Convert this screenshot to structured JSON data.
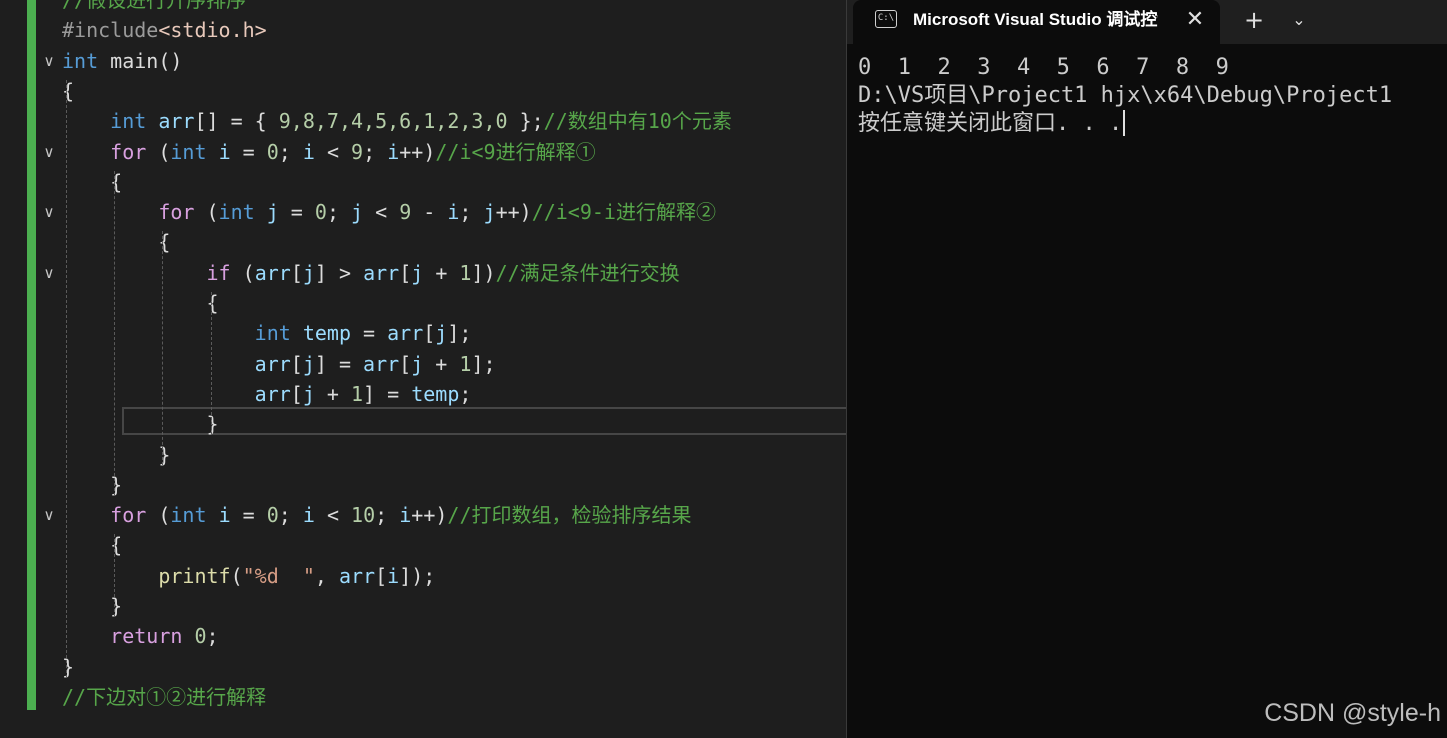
{
  "editor": {
    "lines": [
      {
        "segments": [
          {
            "cls": "cmt",
            "text": "//假设进行升序排序"
          }
        ]
      },
      {
        "segments": [
          {
            "cls": "pp",
            "text": "#include"
          },
          {
            "cls": "inc",
            "text": "<stdio.h>"
          }
        ]
      },
      {
        "segments": [
          {
            "cls": "kw",
            "text": "int"
          },
          {
            "cls": "pl",
            "text": " main()"
          }
        ]
      },
      {
        "segments": [
          {
            "cls": "pl",
            "text": "{"
          }
        ]
      },
      {
        "segments": [
          {
            "cls": "pl",
            "text": "    "
          },
          {
            "cls": "kw",
            "text": "int"
          },
          {
            "cls": "pl",
            "text": " "
          },
          {
            "cls": "id",
            "text": "arr"
          },
          {
            "cls": "pl",
            "text": "[] = { "
          },
          {
            "cls": "num",
            "text": "9,8,7,4,5,6,1,2,3,0"
          },
          {
            "cls": "pl",
            "text": " };"
          },
          {
            "cls": "cmt",
            "text": "//数组中有10个元素"
          }
        ]
      },
      {
        "segments": [
          {
            "cls": "pl",
            "text": "    "
          },
          {
            "cls": "ctl",
            "text": "for"
          },
          {
            "cls": "pl",
            "text": " ("
          },
          {
            "cls": "kw",
            "text": "int"
          },
          {
            "cls": "pl",
            "text": " "
          },
          {
            "cls": "id",
            "text": "i"
          },
          {
            "cls": "pl",
            "text": " = "
          },
          {
            "cls": "num",
            "text": "0"
          },
          {
            "cls": "pl",
            "text": "; "
          },
          {
            "cls": "id",
            "text": "i"
          },
          {
            "cls": "pl",
            "text": " < "
          },
          {
            "cls": "num",
            "text": "9"
          },
          {
            "cls": "pl",
            "text": "; "
          },
          {
            "cls": "id",
            "text": "i"
          },
          {
            "cls": "pl",
            "text": "++)"
          },
          {
            "cls": "cmt",
            "text": "//i<9进行解释①"
          }
        ]
      },
      {
        "segments": [
          {
            "cls": "pl",
            "text": "    {"
          }
        ]
      },
      {
        "segments": [
          {
            "cls": "pl",
            "text": "        "
          },
          {
            "cls": "ctl",
            "text": "for"
          },
          {
            "cls": "pl",
            "text": " ("
          },
          {
            "cls": "kw",
            "text": "int"
          },
          {
            "cls": "pl",
            "text": " "
          },
          {
            "cls": "id",
            "text": "j"
          },
          {
            "cls": "pl",
            "text": " = "
          },
          {
            "cls": "num",
            "text": "0"
          },
          {
            "cls": "pl",
            "text": "; "
          },
          {
            "cls": "id",
            "text": "j"
          },
          {
            "cls": "pl",
            "text": " < "
          },
          {
            "cls": "num",
            "text": "9"
          },
          {
            "cls": "pl",
            "text": " - "
          },
          {
            "cls": "id",
            "text": "i"
          },
          {
            "cls": "pl",
            "text": "; "
          },
          {
            "cls": "id",
            "text": "j"
          },
          {
            "cls": "pl",
            "text": "++)"
          },
          {
            "cls": "cmt",
            "text": "//i<9-i进行解释②"
          }
        ]
      },
      {
        "segments": [
          {
            "cls": "pl",
            "text": "        {"
          }
        ]
      },
      {
        "segments": [
          {
            "cls": "pl",
            "text": "            "
          },
          {
            "cls": "ctl",
            "text": "if"
          },
          {
            "cls": "pl",
            "text": " ("
          },
          {
            "cls": "id",
            "text": "arr"
          },
          {
            "cls": "pl",
            "text": "["
          },
          {
            "cls": "id",
            "text": "j"
          },
          {
            "cls": "pl",
            "text": "] > "
          },
          {
            "cls": "id",
            "text": "arr"
          },
          {
            "cls": "pl",
            "text": "["
          },
          {
            "cls": "id",
            "text": "j"
          },
          {
            "cls": "pl",
            "text": " + "
          },
          {
            "cls": "num",
            "text": "1"
          },
          {
            "cls": "pl",
            "text": "])"
          },
          {
            "cls": "cmt",
            "text": "//满足条件进行交换"
          }
        ]
      },
      {
        "segments": [
          {
            "cls": "pl",
            "text": "            {"
          }
        ]
      },
      {
        "segments": [
          {
            "cls": "pl",
            "text": "                "
          },
          {
            "cls": "kw",
            "text": "int"
          },
          {
            "cls": "pl",
            "text": " "
          },
          {
            "cls": "id",
            "text": "temp"
          },
          {
            "cls": "pl",
            "text": " = "
          },
          {
            "cls": "id",
            "text": "arr"
          },
          {
            "cls": "pl",
            "text": "["
          },
          {
            "cls": "id",
            "text": "j"
          },
          {
            "cls": "pl",
            "text": "];"
          }
        ]
      },
      {
        "segments": [
          {
            "cls": "pl",
            "text": "                "
          },
          {
            "cls": "id",
            "text": "arr"
          },
          {
            "cls": "pl",
            "text": "["
          },
          {
            "cls": "id",
            "text": "j"
          },
          {
            "cls": "pl",
            "text": "] = "
          },
          {
            "cls": "id",
            "text": "arr"
          },
          {
            "cls": "pl",
            "text": "["
          },
          {
            "cls": "id",
            "text": "j"
          },
          {
            "cls": "pl",
            "text": " + "
          },
          {
            "cls": "num",
            "text": "1"
          },
          {
            "cls": "pl",
            "text": "];"
          }
        ]
      },
      {
        "segments": [
          {
            "cls": "pl",
            "text": "                "
          },
          {
            "cls": "id",
            "text": "arr"
          },
          {
            "cls": "pl",
            "text": "["
          },
          {
            "cls": "id",
            "text": "j"
          },
          {
            "cls": "pl",
            "text": " + "
          },
          {
            "cls": "num",
            "text": "1"
          },
          {
            "cls": "pl",
            "text": "] = "
          },
          {
            "cls": "id",
            "text": "temp"
          },
          {
            "cls": "pl",
            "text": ";"
          }
        ]
      },
      {
        "segments": [
          {
            "cls": "pl",
            "text": "            }"
          }
        ]
      },
      {
        "segments": [
          {
            "cls": "pl",
            "text": "        }"
          }
        ]
      },
      {
        "segments": [
          {
            "cls": "pl",
            "text": "    }"
          }
        ]
      },
      {
        "segments": [
          {
            "cls": "pl",
            "text": "    "
          },
          {
            "cls": "ctl",
            "text": "for"
          },
          {
            "cls": "pl",
            "text": " ("
          },
          {
            "cls": "kw",
            "text": "int"
          },
          {
            "cls": "pl",
            "text": " "
          },
          {
            "cls": "id",
            "text": "i"
          },
          {
            "cls": "pl",
            "text": " = "
          },
          {
            "cls": "num",
            "text": "0"
          },
          {
            "cls": "pl",
            "text": "; "
          },
          {
            "cls": "id",
            "text": "i"
          },
          {
            "cls": "pl",
            "text": " < "
          },
          {
            "cls": "num",
            "text": "10"
          },
          {
            "cls": "pl",
            "text": "; "
          },
          {
            "cls": "id",
            "text": "i"
          },
          {
            "cls": "pl",
            "text": "++)"
          },
          {
            "cls": "cmt",
            "text": "//打印数组，检验排序结果"
          }
        ]
      },
      {
        "segments": [
          {
            "cls": "pl",
            "text": "    {"
          }
        ]
      },
      {
        "segments": [
          {
            "cls": "pl",
            "text": "        "
          },
          {
            "cls": "fn",
            "text": "printf"
          },
          {
            "cls": "pl",
            "text": "("
          },
          {
            "cls": "str",
            "text": "\"%d  \""
          },
          {
            "cls": "pl",
            "text": ", "
          },
          {
            "cls": "id",
            "text": "arr"
          },
          {
            "cls": "pl",
            "text": "["
          },
          {
            "cls": "id",
            "text": "i"
          },
          {
            "cls": "pl",
            "text": "]);"
          }
        ]
      },
      {
        "segments": [
          {
            "cls": "pl",
            "text": "    }"
          }
        ]
      },
      {
        "segments": [
          {
            "cls": "pl",
            "text": "    "
          },
          {
            "cls": "ctl",
            "text": "return"
          },
          {
            "cls": "pl",
            "text": " "
          },
          {
            "cls": "num",
            "text": "0"
          },
          {
            "cls": "pl",
            "text": ";"
          }
        ]
      },
      {
        "segments": [
          {
            "cls": "pl",
            "text": "}"
          }
        ]
      },
      {
        "segments": [
          {
            "cls": "cmt",
            "text": "//下边对①②进行解释"
          }
        ]
      }
    ],
    "fold_icon": "chevron-down-icon",
    "fold_glyph": "∨",
    "fold_lines": [
      2,
      5,
      7,
      9,
      17
    ]
  },
  "console": {
    "tab_icon": "terminal-icon",
    "tab_icon_glyph": "C:\\",
    "tab_title": "Microsoft Visual Studio 调试控制台",
    "close_glyph": "✕",
    "new_tab_glyph": "+",
    "dropdown_glyph": "⌄",
    "output": [
      "0  1  2  3  4  5  6  7  8  9",
      "D:\\VS项目\\Project1 hjx\\x64\\Debug\\Project1",
      "按任意键关闭此窗口. . ."
    ]
  },
  "watermark": "CSDN @style-h"
}
